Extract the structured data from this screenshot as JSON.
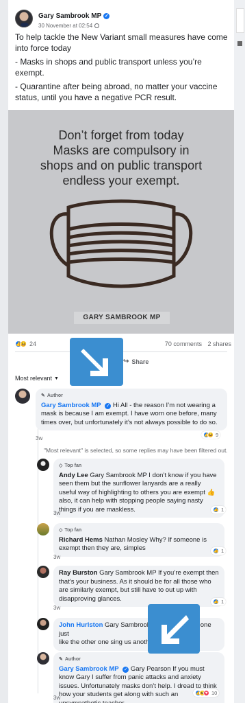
{
  "post": {
    "author": "Gary Sambrook MP",
    "timestamp": "30 November at 02:54",
    "body": [
      "To help tackle the New Variant small measures have come into force today",
      "- Masks in shops and public transport unless you’re exempt.",
      "- Quarantine after being abroad, no matter your vaccine status, until you have a negative PCR result."
    ],
    "image": {
      "caption_lines": [
        "Don’t forget from today",
        "Masks are compulsory in",
        "shops and on public transport",
        "endless your exempt."
      ],
      "banner": "GARY SAMBROOK MP"
    },
    "reactions_count": "24",
    "comments_count": "70 comments",
    "shares_count": "2 shares",
    "share_label": "Share"
  },
  "sort_label": "Most relevant",
  "filter_note": "\"Most relevant\" is selected, so some replies may have been filtered out.",
  "comments": [
    {
      "badge": "Author",
      "name": "Gary Sambrook MP",
      "text": "Hi All - the reason I’m not wearing a mask is because I am exempt. I have worn one before, many times over, but unfortunately it’s not always possible to do so.",
      "time": "3w",
      "reactions": "9"
    },
    {
      "badge": "Top fan",
      "name": "Andy Lee",
      "text": "Gary Sambrook MP I don’t know if you have seen them but the sunflower lanyards are a really useful way of highlighting to others you are exempt 👍 also, it can help with stopping people saying nasty things if you are maskless.",
      "time": "3w",
      "reactions": "1"
    },
    {
      "badge": "Top fan",
      "name": "Richard Hems",
      "text": "Nathan Mosley Why? If someone is exempt then they are, simples",
      "time": "3w",
      "reactions": "1"
    },
    {
      "badge": "",
      "name": "Ray Burston",
      "text": "Gary Sambrook MP If you’re exempt then that’s your business. As it should be for all those who are similarly exempt, but still have to out up with disapproving glances.",
      "time": "3w",
      "reactions": "1"
    },
    {
      "badge": "",
      "name": "John Hurlston",
      "text_a": "Gary Sambrook M",
      "text_b": "one just",
      "text_c": "like the other one sing us anothe",
      "time": "",
      "reactions": ""
    },
    {
      "badge": "Author",
      "name": "Gary Sambrook MP",
      "text": "Gary Pearson If you must know Gary I suffer from panic attacks and anxiety issues. Unfortunately masks don’t help. I dread to think how your students get along with such an unsympathetic teacher.",
      "time": "3w",
      "reactions": "10"
    }
  ],
  "colors": {
    "accent": "#1877f2",
    "overlay_arrow": "#3b8ed0",
    "bubble": "#f0f2f5",
    "image_bg": "#c7c8cb"
  }
}
